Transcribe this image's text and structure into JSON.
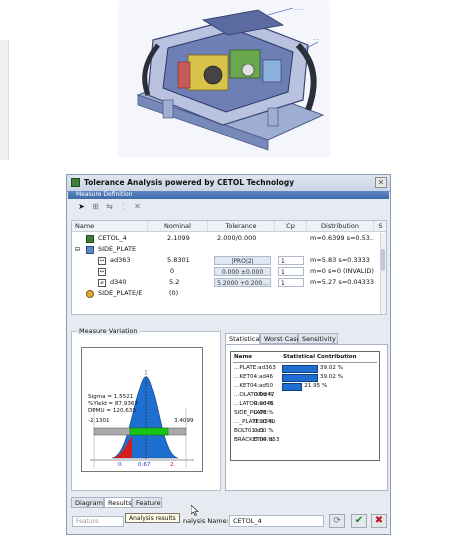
{
  "window": {
    "title": "Tolerance Analysis powered by CETOL Technology",
    "close_glyph": "✕",
    "section_title": "Measure Definition"
  },
  "toolbar": {
    "icons": [
      "pointer-icon",
      "add-measure-icon",
      "link-icon",
      "filter-icon",
      "delete-icon"
    ]
  },
  "table": {
    "columns": [
      "Name",
      "Nominal",
      "Tolerance",
      "Cp",
      "Distribution",
      "S"
    ],
    "rows": [
      {
        "name": "CETOL_4",
        "nominal": "2.1099",
        "tolerance": "2.000/0.000",
        "cp": "",
        "distribution": "m=0.6399 s=0.53..."
      },
      {
        "name": "SIDE_PLATE",
        "nominal": "",
        "tolerance": "",
        "cp": "",
        "distribution": ""
      },
      {
        "name": "ad363",
        "nominal": "5.8301",
        "tolerance": "|PRO|2|",
        "cp": "1",
        "distribution": "m=5.83 s=0.3333"
      },
      {
        "name": "",
        "nominal": "0",
        "tolerance": "0.000 ±0.000",
        "cp": "1",
        "distribution": "m=0 s=0 (INVALID)"
      },
      {
        "name": "d340",
        "nominal": "5.2",
        "tolerance": "5.2000 +0.200...",
        "cp": "1",
        "distribution": "m=5.27 s=0.04333"
      },
      {
        "name": "SIDE_PLATE/E",
        "nominal": "(0)",
        "tolerance": "",
        "cp": "",
        "distribution": ""
      }
    ]
  },
  "measure_variation": {
    "label": "Measure Variation",
    "sigma": "Sigma = 1.5521",
    "yield": "%Yield = 87.9367",
    "dpmu": "DPMU  = 120,633",
    "lower": "-2.1301",
    "upper": "3.4099",
    "mean": "0.67",
    "tick_left": "0.",
    "tick_right": "2."
  },
  "stat_tabs": [
    "Statistical",
    "Worst Case",
    "Sensitivity"
  ],
  "stat_table": {
    "headers": [
      "Name",
      "Statistical Contribution"
    ],
    "rows": [
      {
        "name": "...PLATE:ad363",
        "percent": "39.02 %",
        "value": 39.02
      },
      {
        "name": "...KET04:ad46",
        "percent": "39.02 %",
        "value": 39.02
      },
      {
        "name": "...KET04:ad50",
        "percent": "21.95 %",
        "value": 21.95
      },
      {
        "name": "...OLATOR:d47",
        "percent": "0.00 %",
        "value": 0
      },
      {
        "name": "...LATOR:ad48",
        "percent": "0.00 %",
        "value": 0
      },
      {
        "name": "SIDE_PLATE:",
        "percent": "0.00 %",
        "value": 0
      },
      {
        "name": "..._PLATE:d340",
        "percent": "0.00 %",
        "value": 0
      },
      {
        "name": "BOLT01:d1",
        "percent": "0.00 %",
        "value": 0
      },
      {
        "name": "BRACKET04:d53",
        "percent": "0.00 %",
        "value": 0
      }
    ]
  },
  "bottom_tabs": [
    "Diagram",
    "Results",
    "Feature"
  ],
  "footer": {
    "feature_placeholder": "Feature",
    "tooltip": "Analysis results",
    "analysis_label": "nalysis Name:",
    "analysis_value": "CETOL_4"
  },
  "colors": {
    "bar": "#1f6fd1",
    "accent": "#3d6aa8"
  }
}
